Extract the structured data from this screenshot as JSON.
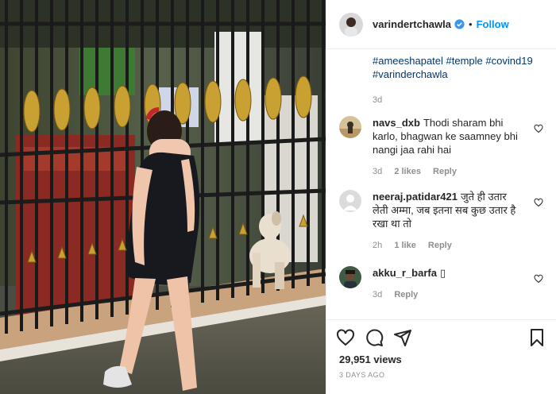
{
  "post": {
    "username": "varindertchawla",
    "follow_label": "Follow",
    "dot": "•",
    "caption_tags": [
      "#ameeshapatel",
      "#temple",
      "#covind19",
      "#varinderchawla"
    ],
    "caption_time": "3d"
  },
  "comments": [
    {
      "user": "navs_dxb",
      "text": "Thodi sharam bhi karlo, bhagwan ke saamney bhi nangi jaa rahi hai",
      "time": "3d",
      "likes": "2 likes",
      "reply": "Reply"
    },
    {
      "user": "neeraj.patidar421",
      "text": "जुते ही उतार लेती अम्मा, जब इतना सब कुछ उतार है रखा था तो",
      "time": "2h",
      "likes": "1 like",
      "reply": "Reply"
    },
    {
      "user": "akku_r_barfa",
      "text": "▯",
      "time": "3d",
      "likes": "",
      "reply": "Reply"
    }
  ],
  "footer": {
    "views": "29,951 views",
    "date": "3 DAYS AGO"
  },
  "icons": [
    "heart-icon",
    "comment-icon",
    "share-icon",
    "bookmark-icon",
    "verified-badge-icon"
  ],
  "colors": {
    "accent": "#0095f6",
    "tag": "#00376b",
    "muted": "#8e8e8e"
  }
}
